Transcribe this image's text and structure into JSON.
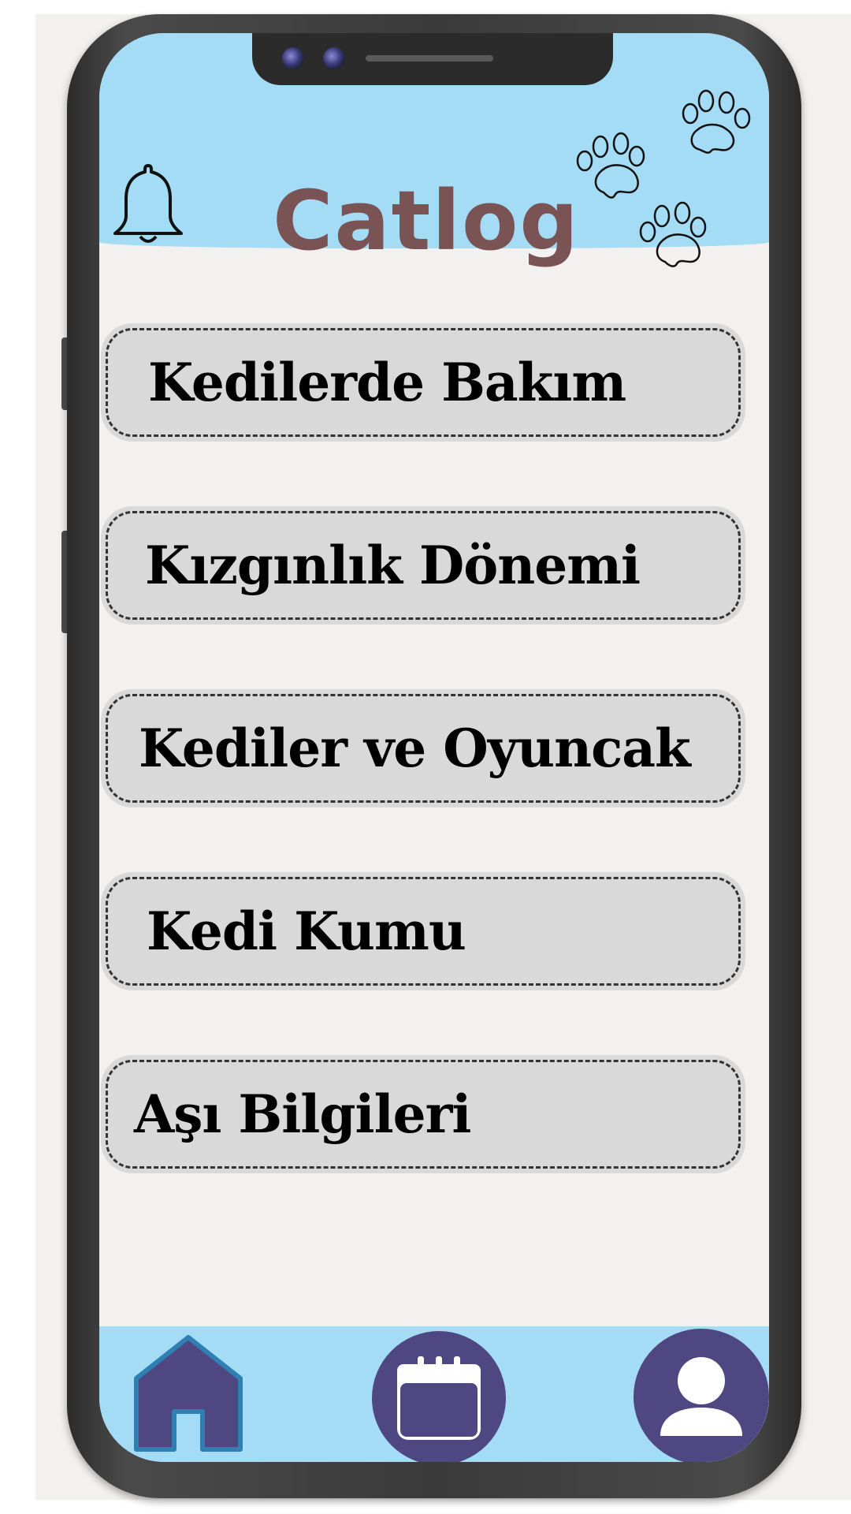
{
  "app": {
    "title": "Catlog"
  },
  "header": {
    "notification_icon": "bell-icon",
    "decoration_icon": "paw-prints-icon"
  },
  "menu": {
    "items": [
      {
        "label": "Kedilerde Bakım"
      },
      {
        "label": "Kızgınlık Dönemi"
      },
      {
        "label": "Kediler ve Oyuncak"
      },
      {
        "label": "Kedi Kumu"
      },
      {
        "label": "Aşı Bilgileri"
      }
    ]
  },
  "nav": {
    "items": [
      {
        "icon": "home-icon"
      },
      {
        "icon": "calendar-icon"
      },
      {
        "icon": "profile-icon"
      }
    ]
  },
  "colors": {
    "accent": "#a4dbf5",
    "title": "#7a5455",
    "nav_icon": "#4f4781",
    "card": "#d9d9d9"
  }
}
